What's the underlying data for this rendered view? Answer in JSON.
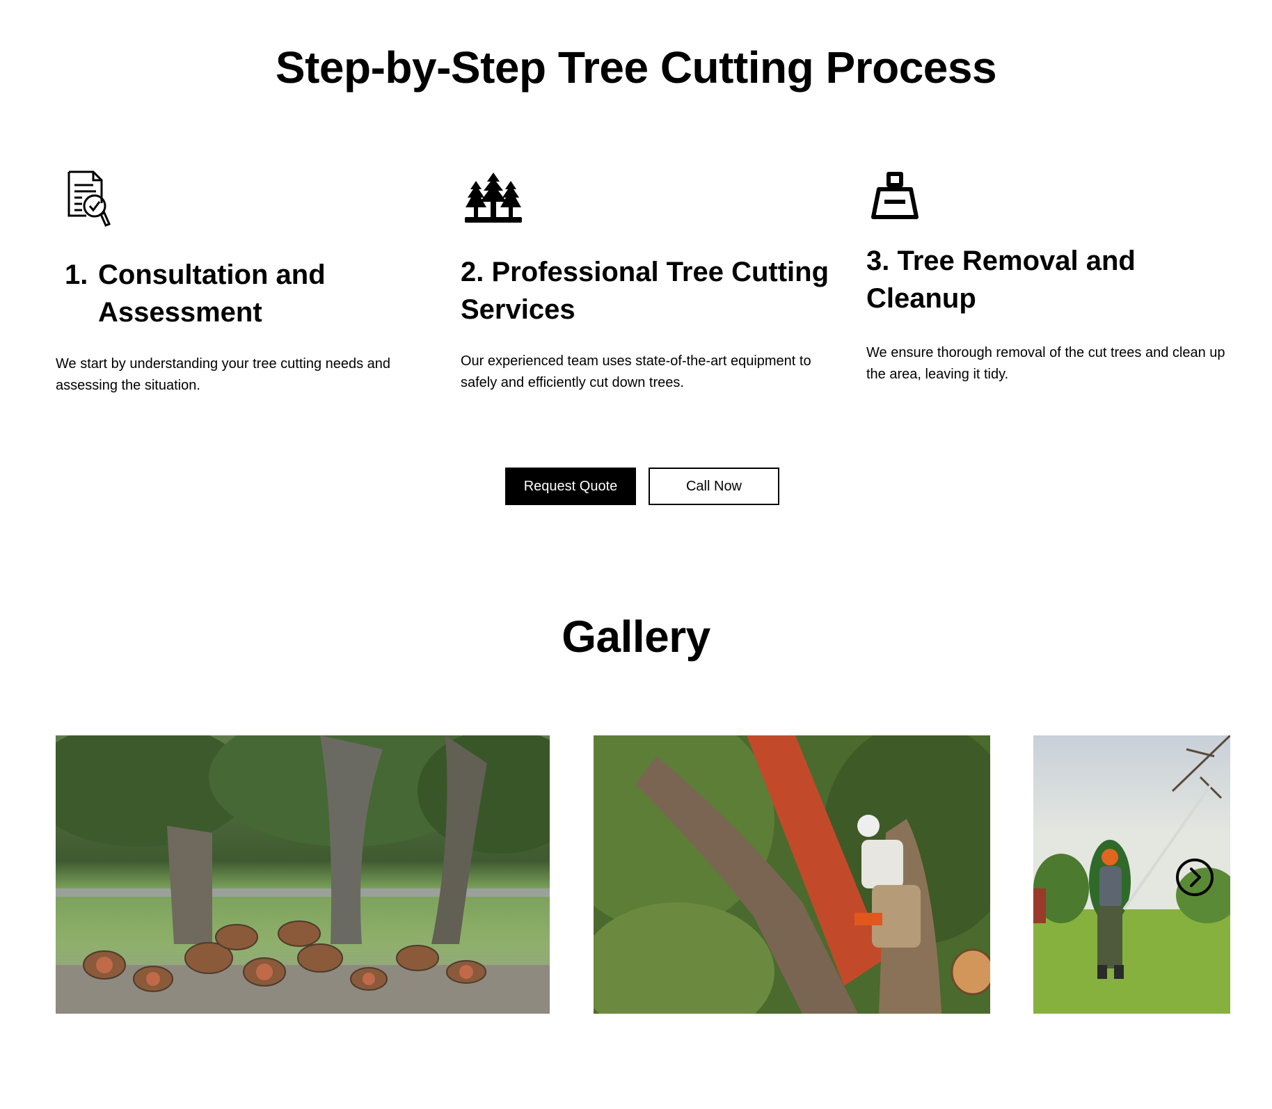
{
  "process": {
    "title": "Step-by-Step Tree Cutting Process",
    "steps": [
      {
        "icon": "document-search-check-icon",
        "number": "1.",
        "title": "Consultation and Assessment",
        "description": "We start by understanding your tree cutting needs and assessing the situation."
      },
      {
        "icon": "pine-trees-icon",
        "title": "2. Professional Tree Cutting Services",
        "description": "Our experienced team uses state-of-the-art equipment to safely and efficiently cut down trees."
      },
      {
        "icon": "brush-cleanup-icon",
        "title": "3. Tree Removal and Cleanup",
        "description": "We ensure thorough removal of the cut trees and clean up the area, leaving it tidy."
      }
    ]
  },
  "buttons": {
    "request_quote": "Request Quote",
    "call_now": "Call Now"
  },
  "gallery": {
    "title": "Gallery",
    "photos": [
      {
        "subject": "cut-logs-pile-photo"
      },
      {
        "subject": "arborist-chainsaw-photo"
      },
      {
        "subject": "pole-saw-pruning-photo"
      }
    ],
    "next_icon": "chevron-right-circle-icon"
  },
  "colors": {
    "text": "#000000",
    "background": "#ffffff",
    "primary_button_bg": "#000000",
    "primary_button_text": "#ffffff"
  }
}
